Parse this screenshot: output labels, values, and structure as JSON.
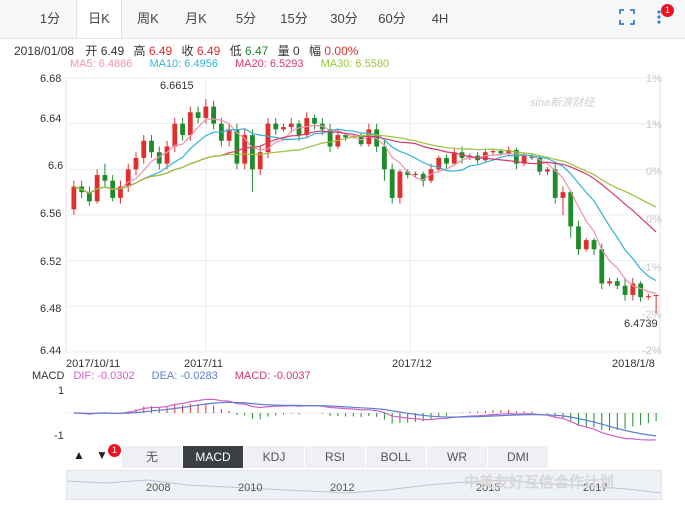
{
  "tabs": [
    {
      "label": "1分"
    },
    {
      "label": "日K"
    },
    {
      "label": "周K"
    },
    {
      "label": "月K"
    },
    {
      "label": "5分"
    },
    {
      "label": "15分"
    },
    {
      "label": "30分"
    },
    {
      "label": "60分"
    },
    {
      "label": "4H"
    }
  ],
  "toolbar": {
    "badge": "1"
  },
  "info": {
    "date": "2018/01/08",
    "open_label": "开",
    "open": "6.49",
    "high_label": "高",
    "high": "6.49",
    "close_label": "收",
    "close": "6.49",
    "low_label": "低",
    "low": "6.47",
    "vol_label": "量",
    "vol": "0",
    "amp_label": "幅",
    "amp": "0.00%"
  },
  "ma": {
    "ma5": "MA5: 6.4886",
    "ma10": "MA10: 6.4956",
    "ma20": "MA20: 6.5293",
    "ma30": "MA30: 6.5580"
  },
  "colors": {
    "up": "#e0302e",
    "down": "#1f8c2b",
    "ma5": "#f08fb0",
    "ma10": "#2fb4d6",
    "ma20": "#d6396a",
    "ma30": "#9ac33a",
    "dif": "#d25fc8",
    "dea": "#5a7fd0"
  },
  "chart_data": {
    "type": "candlestick",
    "symbol_period": "日K",
    "yticks": [
      "6.68",
      "6.64",
      "6.6",
      "6.56",
      "6.52",
      "6.48",
      "6.44"
    ],
    "ylim": [
      6.44,
      6.68
    ],
    "pct_ticks": [
      "1%",
      "1%",
      "0%",
      "0%",
      "-1%",
      "-2%",
      "-2%"
    ],
    "xticks": [
      "2017/10/11",
      "2017/11",
      "2017/12",
      "2018/1/8"
    ],
    "annotations": {
      "high": "6.6615",
      "low": "6.4739"
    },
    "candles": [
      [
        6.565,
        6.585,
        6.56,
        6.59
      ],
      [
        6.585,
        6.58,
        6.575,
        6.59
      ],
      [
        6.58,
        6.572,
        6.568,
        6.585
      ],
      [
        6.572,
        6.595,
        6.57,
        6.6
      ],
      [
        6.595,
        6.59,
        6.585,
        6.605
      ],
      [
        6.59,
        6.575,
        6.572,
        6.595
      ],
      [
        6.575,
        6.585,
        6.57,
        6.59
      ],
      [
        6.585,
        6.6,
        6.58,
        6.605
      ],
      [
        6.6,
        6.61,
        6.595,
        6.615
      ],
      [
        6.61,
        6.625,
        6.605,
        6.63
      ],
      [
        6.625,
        6.615,
        6.61,
        6.63
      ],
      [
        6.615,
        6.605,
        6.6,
        6.62
      ],
      [
        6.605,
        6.62,
        6.6,
        6.625
      ],
      [
        6.62,
        6.64,
        6.615,
        6.645
      ],
      [
        6.64,
        6.63,
        6.625,
        6.645
      ],
      [
        6.63,
        6.65,
        6.625,
        6.655
      ],
      [
        6.65,
        6.645,
        6.64,
        6.655
      ],
      [
        6.645,
        6.655,
        6.64,
        6.6615
      ],
      [
        6.655,
        6.64,
        6.635,
        6.66
      ],
      [
        6.64,
        6.625,
        6.62,
        6.645
      ],
      [
        6.625,
        6.635,
        6.62,
        6.64
      ],
      [
        6.635,
        6.605,
        6.6,
        6.64
      ],
      [
        6.605,
        6.63,
        6.6,
        6.635
      ],
      [
        6.63,
        6.6,
        6.58,
        6.635
      ],
      [
        6.6,
        6.615,
        6.595,
        6.62
      ],
      [
        6.615,
        6.64,
        6.61,
        6.645
      ],
      [
        6.64,
        6.635,
        6.63,
        6.645
      ],
      [
        6.635,
        6.637,
        6.633,
        6.64
      ],
      [
        6.637,
        6.64,
        6.632,
        6.645
      ],
      [
        6.64,
        6.63,
        6.625,
        6.643
      ],
      [
        6.63,
        6.645,
        6.628,
        6.65
      ],
      [
        6.645,
        6.64,
        6.635,
        6.648
      ],
      [
        6.64,
        6.635,
        6.63,
        6.645
      ],
      [
        6.635,
        6.62,
        6.615,
        6.64
      ],
      [
        6.62,
        6.63,
        6.618,
        6.635
      ],
      [
        6.63,
        6.628,
        6.625,
        6.632
      ],
      [
        6.628,
        6.629,
        6.627,
        6.63
      ],
      [
        6.629,
        6.622,
        6.62,
        6.632
      ],
      [
        6.622,
        6.635,
        6.62,
        6.64
      ],
      [
        6.635,
        6.62,
        6.615,
        6.64
      ],
      [
        6.62,
        6.6,
        6.59,
        6.625
      ],
      [
        6.6,
        6.575,
        6.57,
        6.605
      ],
      [
        6.575,
        6.598,
        6.57,
        6.6
      ],
      [
        6.598,
        6.595,
        6.592,
        6.6
      ],
      [
        6.595,
        6.596,
        6.593,
        6.598
      ],
      [
        6.596,
        6.59,
        6.585,
        6.598
      ],
      [
        6.59,
        6.6,
        6.588,
        6.605
      ],
      [
        6.6,
        6.61,
        6.598,
        6.612
      ],
      [
        6.61,
        6.605,
        6.6,
        6.613
      ],
      [
        6.605,
        6.615,
        6.603,
        6.618
      ],
      [
        6.615,
        6.61,
        6.605,
        6.62
      ],
      [
        6.61,
        6.612,
        6.608,
        6.614
      ],
      [
        6.612,
        6.608,
        6.605,
        6.615
      ],
      [
        6.608,
        6.615,
        6.606,
        6.618
      ],
      [
        6.615,
        6.616,
        6.613,
        6.618
      ],
      [
        6.616,
        6.614,
        6.612,
        6.618
      ],
      [
        6.614,
        6.617,
        6.612,
        6.62
      ],
      [
        6.617,
        6.605,
        6.6,
        6.619
      ],
      [
        6.605,
        6.612,
        6.603,
        6.615
      ],
      [
        6.612,
        6.61,
        6.608,
        6.614
      ],
      [
        6.61,
        6.598,
        6.595,
        6.612
      ],
      [
        6.598,
        6.6,
        6.595,
        6.602
      ],
      [
        6.6,
        6.575,
        6.57,
        6.605
      ],
      [
        6.575,
        6.58,
        6.56,
        6.585
      ],
      [
        6.58,
        6.55,
        6.54,
        6.582
      ],
      [
        6.55,
        6.53,
        6.525,
        6.555
      ],
      [
        6.53,
        6.538,
        6.528,
        6.54
      ],
      [
        6.538,
        6.53,
        6.525,
        6.54
      ],
      [
        6.53,
        6.5,
        6.495,
        6.535
      ],
      [
        6.5,
        6.502,
        6.498,
        6.505
      ],
      [
        6.502,
        6.498,
        6.495,
        6.505
      ],
      [
        6.498,
        6.49,
        6.485,
        6.505
      ],
      [
        6.49,
        6.5,
        6.485,
        6.505
      ],
      [
        6.5,
        6.488,
        6.484,
        6.502
      ],
      [
        6.488,
        6.489,
        6.486,
        6.491
      ],
      [
        6.489,
        6.49,
        6.474,
        6.49
      ]
    ],
    "macd": {
      "labels": {
        "macd": "MACD",
        "dif": "DIF: -0.0302",
        "dea": "DEA: -0.0283",
        "hist": "MACD: -0.0037"
      },
      "yticks": [
        "1",
        "-1"
      ]
    }
  },
  "indicators": [
    {
      "label": "无"
    },
    {
      "label": "MACD"
    },
    {
      "label": "KDJ"
    },
    {
      "label": "RSI"
    },
    {
      "label": "BOLL"
    },
    {
      "label": "WR"
    },
    {
      "label": "DMI"
    }
  ],
  "indicator_badge": "1",
  "nav": {
    "years": [
      "2008",
      "2010",
      "2012",
      "2015",
      "2017"
    ]
  },
  "watermark": "中美友好互信合作计划",
  "brand": "sina新浪财经"
}
